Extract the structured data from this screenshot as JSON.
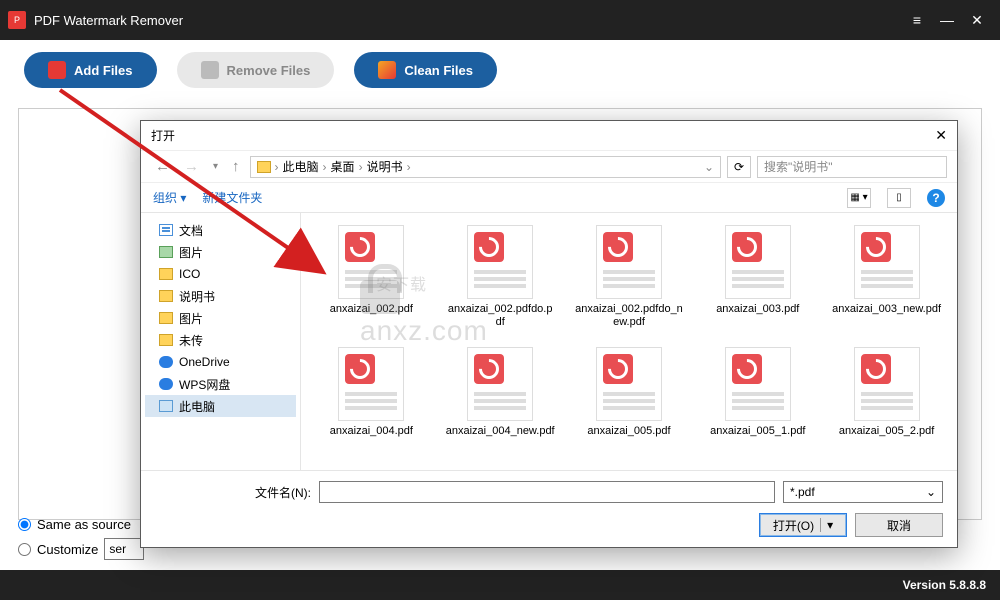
{
  "app": {
    "title": "PDF Watermark Remover"
  },
  "toolbar": {
    "add": "Add Files",
    "remove": "Remove Files",
    "clean": "Clean Files"
  },
  "options": {
    "same": "Same as source",
    "custom": "Customize",
    "custom_value": "ser"
  },
  "footer": {
    "version": "Version 5.8.8.8"
  },
  "dialog": {
    "title": "打开",
    "crumbs": [
      "此电脑",
      "桌面",
      "说明书"
    ],
    "search_placeholder": "搜索\"说明书\"",
    "organize": "组织",
    "newfolder": "新建文件夹",
    "tree": [
      {
        "label": "文档",
        "icon": "doc"
      },
      {
        "label": "图片",
        "icon": "pic"
      },
      {
        "label": "ICO",
        "icon": "fld"
      },
      {
        "label": "说明书",
        "icon": "fld"
      },
      {
        "label": "图片",
        "icon": "fld"
      },
      {
        "label": "未传",
        "icon": "fld"
      },
      {
        "label": "OneDrive",
        "icon": "cloud"
      },
      {
        "label": "WPS网盘",
        "icon": "cloud"
      },
      {
        "label": "此电脑",
        "icon": "pc",
        "sel": true
      }
    ],
    "files": [
      "anxaizai_002.pdf",
      "anxaizai_002.pdfdo.pdf",
      "anxaizai_002.pdfdo_new.pdf",
      "anxaizai_003.pdf",
      "anxaizai_003_new.pdf",
      "anxaizai_004.pdf",
      "anxaizai_004_new.pdf",
      "anxaizai_005.pdf",
      "anxaizai_005_1.pdf",
      "anxaizai_005_2.pdf"
    ],
    "filename_label": "文件名(N):",
    "filter": "*.pdf",
    "open": "打开(O)",
    "cancel": "取消"
  },
  "watermark": "anxz.com"
}
